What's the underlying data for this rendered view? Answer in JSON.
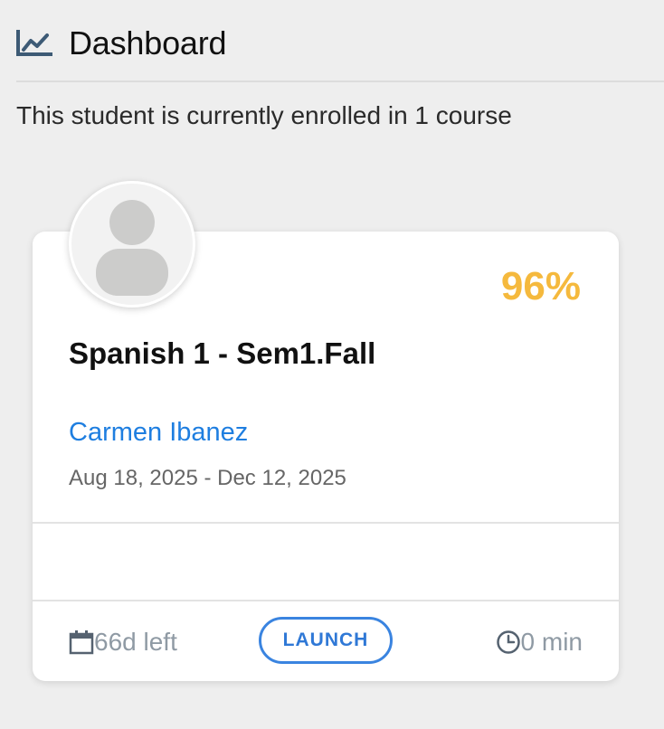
{
  "header": {
    "title": "Dashboard",
    "icon": "line-chart-icon"
  },
  "enrollment_text": "This student is currently enrolled in 1 course",
  "course_card": {
    "avatar_icon": "user-avatar-icon",
    "grade": "96%",
    "title": "Spanish 1 - Sem1.Fall",
    "teacher": "Carmen Ibanez",
    "dates": "Aug 18, 2025 - Dec 12, 2025",
    "days_left": "66d left",
    "days_left_icon": "calendar-icon",
    "launch_label": "LAUNCH",
    "time_spent": "0 min",
    "time_spent_icon": "clock-icon"
  },
  "colors": {
    "grade": "#f5b93d",
    "link": "#1e7ee0",
    "button_border": "#3a84e0",
    "muted": "#8f9aa4",
    "header_icon": "#3d5a75"
  }
}
